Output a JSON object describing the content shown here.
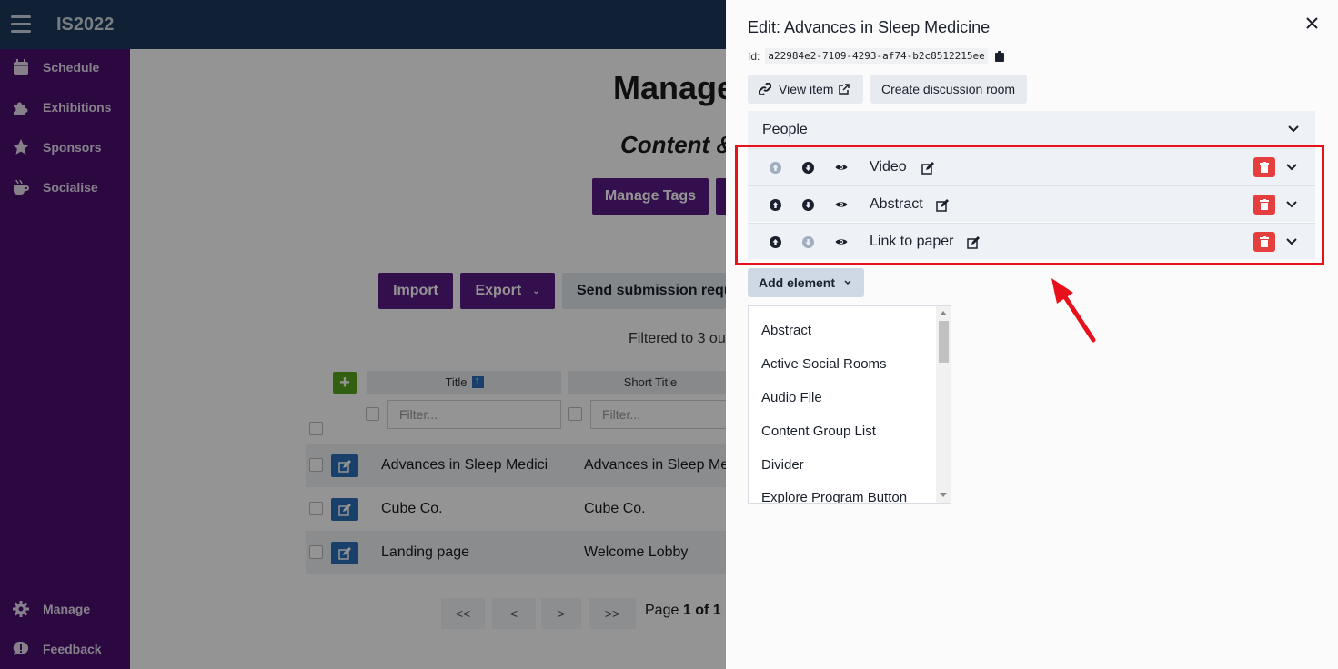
{
  "app": {
    "title": "IS2022"
  },
  "sidebar": {
    "items": [
      {
        "label": "Schedule",
        "icon": "calendar-icon"
      },
      {
        "label": "Exhibitions",
        "icon": "puzzle-icon"
      },
      {
        "label": "Sponsors",
        "icon": "star-icon"
      },
      {
        "label": "Socialise",
        "icon": "coffee-icon"
      }
    ],
    "bottom_items": [
      {
        "label": "Manage",
        "icon": "gear-icon"
      },
      {
        "label": "Feedback",
        "icon": "feedback-icon"
      }
    ]
  },
  "main": {
    "title": "Manage",
    "subtitle": "Content &",
    "buttons": {
      "manage_tags": "Manage Tags",
      "import": "Import",
      "export": "Export",
      "send_requests": "Send submission requests"
    },
    "filtered_text": "Filtered to 3 ou",
    "table": {
      "columns": [
        "Title",
        "Short Title"
      ],
      "sort_indicator": "1",
      "filter_placeholder": "Filter...",
      "rows": [
        {
          "title": "Advances in Sleep Medicine",
          "short_title": "Advances in Sleep Medicine"
        },
        {
          "title": "Cube Co.",
          "short_title": "Cube Co."
        },
        {
          "title": "Landing page",
          "short_title": "Welcome Lobby"
        }
      ]
    },
    "pagination": {
      "first": "<<",
      "prev": "<",
      "next": ">",
      "last": ">>",
      "page_prefix": "Page",
      "current": "1",
      "of_label": "of",
      "total": "1"
    }
  },
  "drawer": {
    "title": "Edit: Advances in Sleep Medicine",
    "id_label": "Id:",
    "id_value": "a22984e2-7109-4293-af74-b2c8512215ee",
    "view_item_label": "View item",
    "create_room_label": "Create discussion room",
    "people_label": "People",
    "elements": [
      {
        "label": "Video",
        "up_enabled": false,
        "down_enabled": true
      },
      {
        "label": "Abstract",
        "up_enabled": true,
        "down_enabled": true
      },
      {
        "label": "Link to paper",
        "up_enabled": true,
        "down_enabled": false
      }
    ],
    "add_element_label": "Add element",
    "element_types": [
      "Abstract",
      "Active Social Rooms",
      "Audio File",
      "Content Group List",
      "Divider",
      "Explore Program Button"
    ]
  },
  "colors": {
    "topbar": "#1e3a5c",
    "sidebar": "#4a0e6e",
    "primary_button": "#5b1a86",
    "danger": "#e53e3e",
    "highlight": "#e8101a"
  }
}
